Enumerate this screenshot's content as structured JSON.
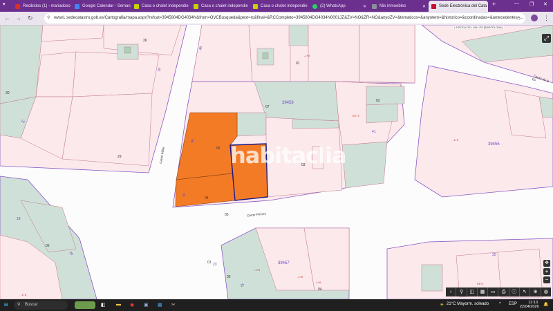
{
  "tabs": [
    {
      "label": "Recibidos (1) - mariadoso",
      "color": "#d93025"
    },
    {
      "label": "Google Calendar - Seman",
      "color": "#4285f4"
    },
    {
      "label": "Casa o chalet independie",
      "color": "#c5d300"
    },
    {
      "label": "Casa o chalet independie",
      "color": "#c5d300"
    },
    {
      "label": "Casa o chalet independie",
      "color": "#c5d300"
    },
    {
      "label": "(2) WhatsApp",
      "color": "#25d366"
    },
    {
      "label": "Mis inmuebles",
      "color": "#5f6368"
    },
    {
      "label": "Sede Electrónica del Cata",
      "color": "#c8102e"
    }
  ],
  "new_tab": "+",
  "url": "www1.sedecatastro.gob.es/Cartografia/mapa.aspx?refcat=3945804DG4034N&from=OVCBusqueda&pest=rc&final=&RCCompleto=3945804DG4034N0001JZ&ZV=NO&ZR=NO&anyoZV=&tematicos=&anyotem=&historico=&coordinadas=&antecedentes=...",
  "map": {
    "municipality": "LA ROCA DEL VALLES [BARCELONA]",
    "watermark": "habitaclia",
    "streets": [
      "Carrer Miller",
      "Carrer Pirineu",
      "Carrer de la Es"
    ],
    "block_numbers": [
      "39458",
      "39455",
      "39457"
    ],
    "parcel_numbers": [
      "26",
      "30",
      "29",
      "01",
      "07",
      "02",
      "06",
      "05",
      "04",
      "03",
      "01",
      "02",
      "04",
      "05",
      "20",
      "18",
      "23",
      "25",
      "14",
      "19",
      "48",
      "45",
      "46",
      "41",
      "40"
    ],
    "small_labels": [
      "8",
      "8",
      "8",
      "1",
      "8",
      "8",
      "8",
      "1",
      "8",
      "1",
      "8",
      "8",
      "8",
      "8",
      "8",
      "8",
      "8",
      "8",
      "8",
      "8",
      "1",
      "8",
      "8",
      "8"
    ],
    "markers": [
      "-1+8",
      "-1+8",
      "EE+1",
      "-1+8",
      "-1+8",
      "-1+8",
      "-1+8",
      "EE+1"
    ]
  },
  "toolbar_icons": [
    "arrow-right-icon",
    "search-icon",
    "layers-icon",
    "grid-icon",
    "ruler-icon",
    "print-icon",
    "info-icon",
    "pointer-icon",
    "zoom-icon",
    "globe-icon"
  ],
  "taskbar": {
    "search": "Buscar",
    "weather": "21°C Mayorm. soleado",
    "lang": "ESP",
    "time": "12:13",
    "date": "22/04/2026"
  }
}
